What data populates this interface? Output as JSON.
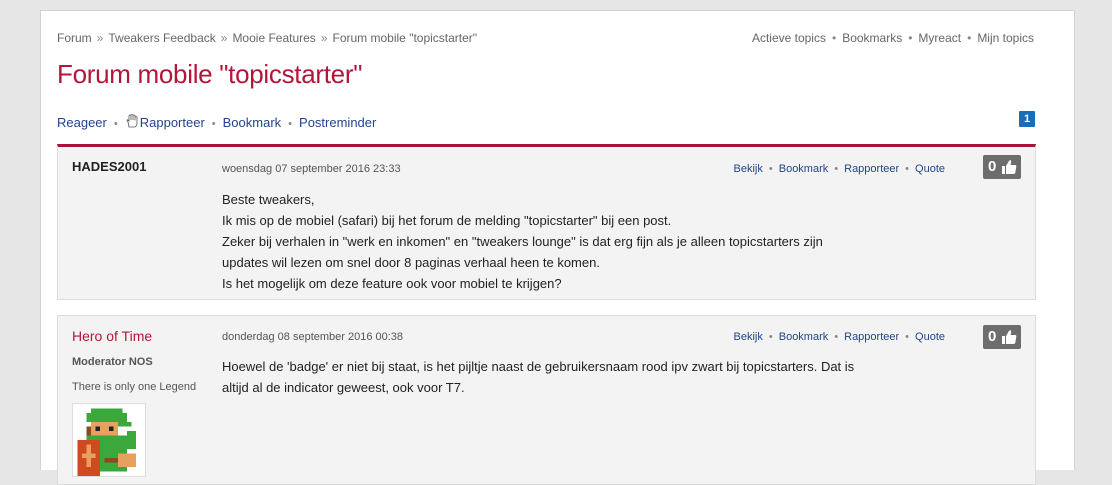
{
  "breadcrumb": [
    "Forum",
    "Tweakers Feedback",
    "Mooie Features",
    "Forum mobile \"topicstarter\""
  ],
  "breadcrumb_separator": "»",
  "quicklinks": [
    "Actieve topics",
    "Bookmarks",
    "Myreact",
    "Mijn topics"
  ],
  "title": "Forum mobile \"topicstarter\"",
  "actions": {
    "reply": "Reageer",
    "report": "Rapporteer",
    "bookmark": "Bookmark",
    "postreminder": "Postreminder"
  },
  "page_number": "1",
  "colors": {
    "accent_red": "#b5153a",
    "link_blue": "#23458a",
    "badge_blue": "#1a6eb8",
    "kudos_gray": "#6d6d6d"
  },
  "posts": [
    {
      "author": "HADES2001",
      "date": "woensdag 07 september 2016 23:33",
      "links": [
        "Bekijk",
        "Bookmark",
        "Rapporteer",
        "Quote"
      ],
      "kudos": "0",
      "lines": [
        "Beste tweakers,",
        "Ik mis op de mobiel (safari) bij het forum de melding \"topicstarter\" bij een post.",
        "Zeker bij verhalen in \"werk en inkomen\" en \"tweakers lounge\" is dat erg fijn als je alleen topicstarters zijn",
        "updates wil lezen om snel door 8 paginas verhaal heen te komen.",
        "Is het mogelijk om deze feature ook voor mobiel te krijgen?"
      ]
    },
    {
      "author": "Hero of Time",
      "role": "Moderator NOS",
      "tagline": "There is only one Legend",
      "avatar_icon": "link-pixel-avatar-icon",
      "date": "donderdag 08 september 2016 00:38",
      "links": [
        "Bekijk",
        "Bookmark",
        "Rapporteer",
        "Quote"
      ],
      "kudos": "0",
      "lines": [
        "Hoewel de 'badge' er niet bij staat, is het pijltje naast de gebruikersnaam rood ipv zwart bij topicstarters. Dat is",
        "altijd al de indicator geweest, ook voor T7."
      ]
    }
  ]
}
